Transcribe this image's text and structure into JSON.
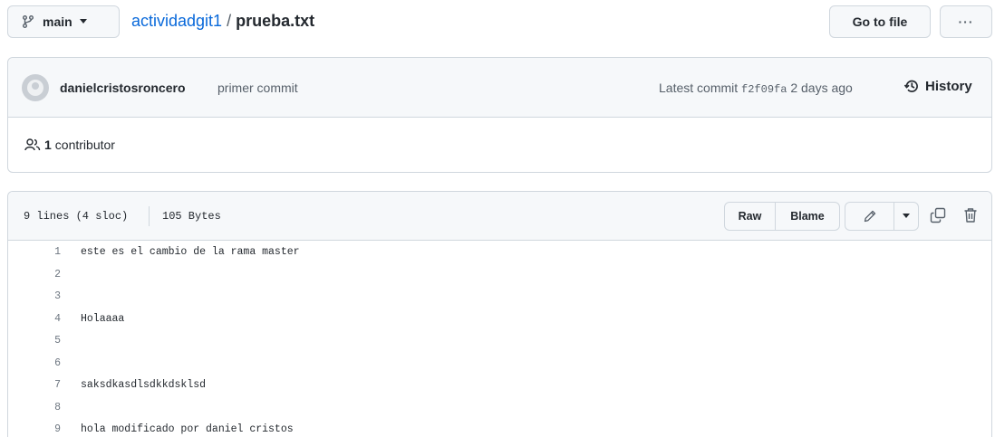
{
  "repo_nav": {
    "branch_label": "main",
    "repo_link": "actividadgit1",
    "separator": "/",
    "file_name": "prueba.txt",
    "go_to_file_label": "Go to file",
    "more_label": "···"
  },
  "commit": {
    "author": "danielcristosroncero",
    "message": "primer commit",
    "latest_prefix": "Latest commit",
    "hash": "f2f09fa",
    "time": "2 days ago",
    "history_label": "History"
  },
  "contributors": {
    "count": "1",
    "label": "contributor"
  },
  "file_header": {
    "lines_info": "9 lines (4 sloc)",
    "size": "105 Bytes",
    "raw_label": "Raw",
    "blame_label": "Blame"
  },
  "code": {
    "lines": [
      {
        "num": "1",
        "text": "este es el cambio de la rama master"
      },
      {
        "num": "2",
        "text": ""
      },
      {
        "num": "3",
        "text": ""
      },
      {
        "num": "4",
        "text": "Holaaaa"
      },
      {
        "num": "5",
        "text": ""
      },
      {
        "num": "6",
        "text": ""
      },
      {
        "num": "7",
        "text": "saksdkasdlsdkkdsklsd"
      },
      {
        "num": "8",
        "text": ""
      },
      {
        "num": "9",
        "text": "hola modificado por daniel cristos"
      }
    ]
  },
  "colors": {
    "link": "#0969da",
    "border": "#d0d7de",
    "muted": "#57606a",
    "button_bg": "#f6f8fa"
  }
}
